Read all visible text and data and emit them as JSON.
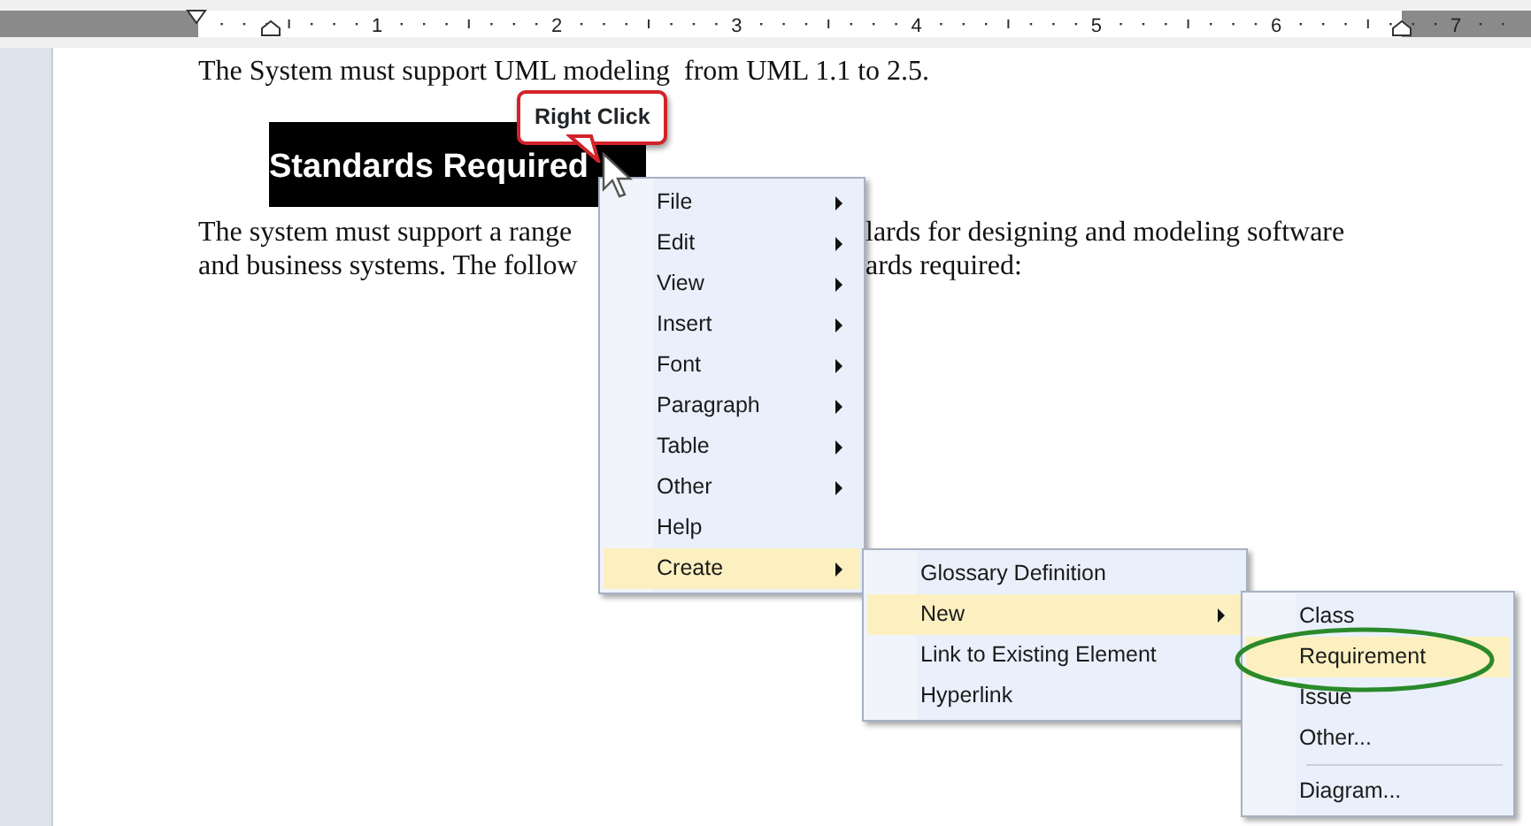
{
  "ruler": {
    "numbers": [
      "1",
      "2",
      "3",
      "4",
      "5",
      "6",
      "7"
    ]
  },
  "document": {
    "line_1": "The System must support UML modeling  from UML 1.1 to 2.5.",
    "heading": "Standards Required",
    "line_2_left": "The system must support a range",
    "line_2_right": "lards for designing and modeling software",
    "line_3_left": "and business systems. The follow",
    "line_3_right": "ards required:"
  },
  "callout": {
    "text": "Right Click"
  },
  "context_menu": [
    {
      "label": "File",
      "submenu": true,
      "selected": false
    },
    {
      "label": "Edit",
      "submenu": true,
      "selected": false
    },
    {
      "label": "View",
      "submenu": true,
      "selected": false
    },
    {
      "label": "Insert",
      "submenu": true,
      "selected": false
    },
    {
      "label": "Font",
      "submenu": true,
      "selected": false
    },
    {
      "label": "Paragraph",
      "submenu": true,
      "selected": false
    },
    {
      "label": "Table",
      "submenu": true,
      "selected": false
    },
    {
      "label": "Other",
      "submenu": true,
      "selected": false
    },
    {
      "label": "Help",
      "submenu": false,
      "selected": false
    },
    {
      "label": "Create",
      "submenu": true,
      "selected": true
    }
  ],
  "create_menu": [
    {
      "label": "Glossary Definition",
      "submenu": false,
      "selected": false
    },
    {
      "label": "New",
      "submenu": true,
      "selected": true
    },
    {
      "label": "Link to Existing Element",
      "submenu": false,
      "selected": false
    },
    {
      "label": "Hyperlink",
      "submenu": false,
      "selected": false
    }
  ],
  "new_menu": [
    {
      "label": "Class",
      "submenu": false,
      "selected": false,
      "circled": false,
      "separator_before": false
    },
    {
      "label": "Requirement",
      "submenu": false,
      "selected": true,
      "circled": true,
      "separator_before": false
    },
    {
      "label": "Issue",
      "submenu": false,
      "selected": false,
      "circled": false,
      "separator_before": false
    },
    {
      "label": "Other...",
      "submenu": false,
      "selected": false,
      "circled": false,
      "separator_before": false
    },
    {
      "label": "Diagram...",
      "submenu": false,
      "selected": false,
      "circled": false,
      "separator_before": true
    }
  ]
}
